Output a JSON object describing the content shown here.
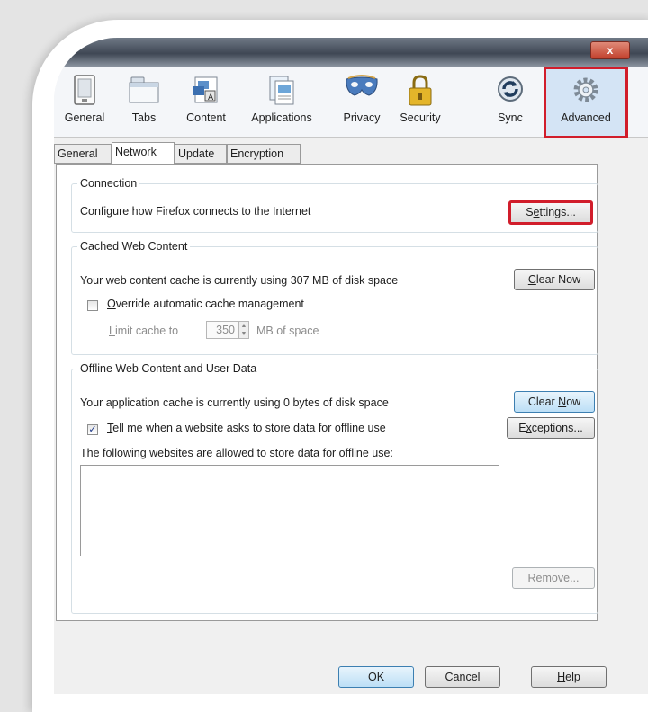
{
  "window": {
    "close_label": "x"
  },
  "toolbar": {
    "items": [
      {
        "label": "General",
        "icon": "general-icon"
      },
      {
        "label": "Tabs",
        "icon": "tabs-icon"
      },
      {
        "label": "Content",
        "icon": "content-icon"
      },
      {
        "label": "Applications",
        "icon": "applications-icon"
      },
      {
        "label": "Privacy",
        "icon": "privacy-mask-icon"
      },
      {
        "label": "Security",
        "icon": "padlock-icon"
      },
      {
        "label": "Sync",
        "icon": "sync-icon"
      },
      {
        "label": "Advanced",
        "icon": "gear-icon"
      }
    ],
    "highlight_color": "#d11d2b"
  },
  "subtabs": [
    "General",
    "Network",
    "Update",
    "Encryption"
  ],
  "connection": {
    "legend": "Connection",
    "description": "Configure how Firefox connects to the Internet",
    "settings_pre": "S",
    "settings_key": "e",
    "settings_post": "ttings..."
  },
  "cache": {
    "legend": "Cached Web Content",
    "description": "Your web content cache is currently using 307 MB of disk space",
    "clear_key": "C",
    "clear_post": "lear Now",
    "override_key": "O",
    "override_post": "verride automatic cache management",
    "limit_key": "L",
    "limit_post": "imit cache to",
    "limit_value": "350",
    "limit_unit": "MB of space"
  },
  "offline": {
    "legend": "Offline Web Content and User Data",
    "description": "Your application cache is currently using 0 bytes of disk space",
    "clear_pre": "Clear ",
    "clear_key": "N",
    "clear_post": "ow",
    "tell_key": "T",
    "tell_post": "ell me when a website asks to store data for offline use",
    "exceptions_pre": "E",
    "exceptions_key": "x",
    "exceptions_post": "ceptions...",
    "allowed_label": "The following websites are allowed to store data for offline use:",
    "remove_key": "R",
    "remove_post": "emove..."
  },
  "footer": {
    "ok": "OK",
    "cancel": "Cancel",
    "help_key": "H",
    "help_post": "elp"
  }
}
